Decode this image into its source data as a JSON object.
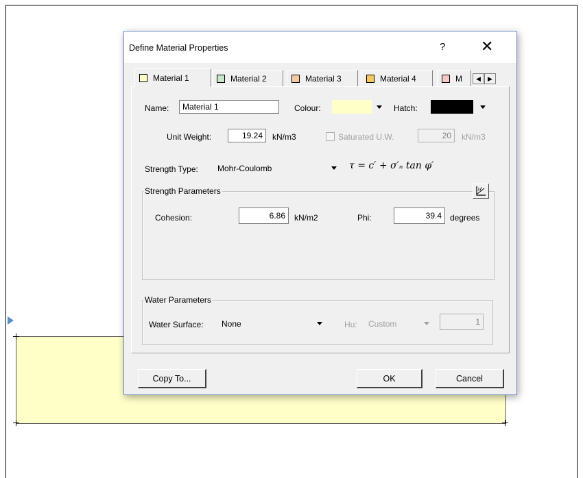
{
  "dialog": {
    "title": "Define Material Properties",
    "help_label": "?",
    "close_label": "✕"
  },
  "tabs": [
    {
      "label": "Material 1",
      "color": "#ffffc8",
      "active": true
    },
    {
      "label": "Material 2",
      "color": "#c8e6c8"
    },
    {
      "label": "Material 3",
      "color": "#f8c8a0"
    },
    {
      "label": "Material 4",
      "color": "#f8c860"
    },
    {
      "label": "M",
      "color": "#f8c8c8"
    }
  ],
  "tab_scroll": {
    "left": "◀",
    "right": "▶"
  },
  "name": {
    "label": "Name:",
    "value": "Material 1"
  },
  "colour": {
    "label": "Colour:",
    "value_color": "#ffffc8"
  },
  "hatch": {
    "label": "Hatch:",
    "value_color": "#000000"
  },
  "unit_weight": {
    "label": "Unit Weight:",
    "value": "19.24",
    "unit": "kN/m3"
  },
  "saturated": {
    "label": "Saturated U.W.",
    "value": "20",
    "unit": "kN/m3",
    "checked": false
  },
  "strength_type": {
    "label": "Strength Type:",
    "value": "Mohr-Coulomb",
    "formula": "τ = c′ + σ′ₙ tan φ′"
  },
  "strength_params": {
    "title": "Strength Parameters",
    "cohesion_label": "Cohesion:",
    "cohesion_value": "6.86",
    "cohesion_unit": "kN/m2",
    "phi_label": "Phi:",
    "phi_value": "39.4",
    "phi_unit": "degrees"
  },
  "water_params": {
    "title": "Water Parameters",
    "surface_label": "Water Surface:",
    "surface_value": "None",
    "hu_label": "Hu:",
    "hu_value": "Custom",
    "hu_number": "1"
  },
  "buttons": {
    "copy_to": "Copy To...",
    "ok": "OK",
    "cancel": "Cancel"
  },
  "colors": {
    "soil_fill": "#ffffc8",
    "arrow": "#5a8dc8"
  }
}
